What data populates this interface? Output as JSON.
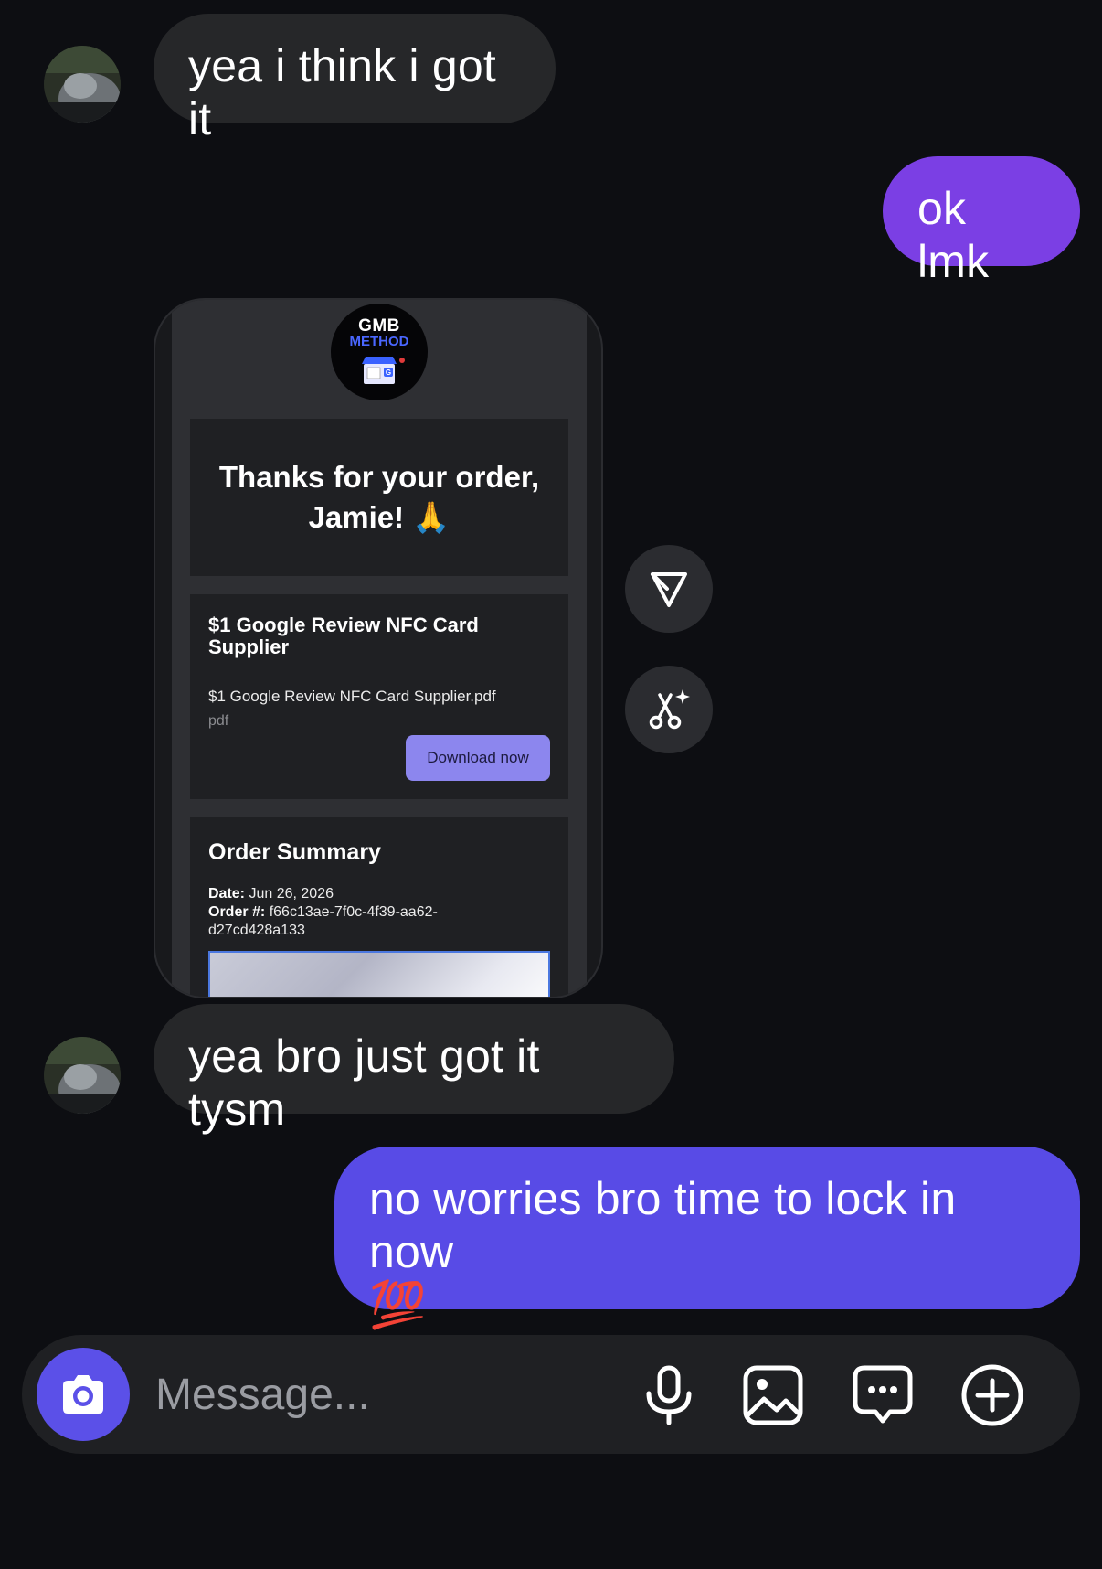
{
  "messages": [
    {
      "id": "m1",
      "direction": "incoming",
      "text": "yea i think i got it"
    },
    {
      "id": "m2",
      "direction": "outgoing",
      "text": "ok lmk",
      "color": "#7b3fe4"
    },
    {
      "id": "m3",
      "direction": "incoming",
      "text": "yea bro just got it tysm"
    },
    {
      "id": "m4",
      "direction": "outgoing",
      "text": "no worries bro time to lock in now",
      "emoji": "💯",
      "color": "#584be6"
    }
  ],
  "email_card": {
    "logo": {
      "line1": "GMB",
      "line2": "METHOD"
    },
    "thanks": {
      "line1": "Thanks for your order,",
      "line2": "Jamie! 🙏"
    },
    "product": {
      "title": "$1 Google Review NFC Card Supplier",
      "file_name": "$1 Google Review NFC Card Supplier.pdf",
      "file_type": "pdf",
      "download_label": "Download now"
    },
    "summary": {
      "title": "Order Summary",
      "date_label": "Date:",
      "date_value": "Jun 26, 2026",
      "order_label": "Order #:",
      "order_value": "f66c13ae-7f0c-4f39-aa62-",
      "order_value_cont": "d27cd428a133"
    }
  },
  "actions": {
    "share_icon": "send-icon",
    "ai_edit_icon": "scissors-sparkle-icon"
  },
  "composer": {
    "placeholder": "Message...",
    "camera_icon": "camera-icon",
    "tools": [
      "microphone-icon",
      "image-icon",
      "sticker-icon",
      "plus-icon"
    ]
  },
  "colors": {
    "background": "#0d0e12",
    "incoming_bubble": "#262729",
    "accent": "#5b50e8"
  }
}
